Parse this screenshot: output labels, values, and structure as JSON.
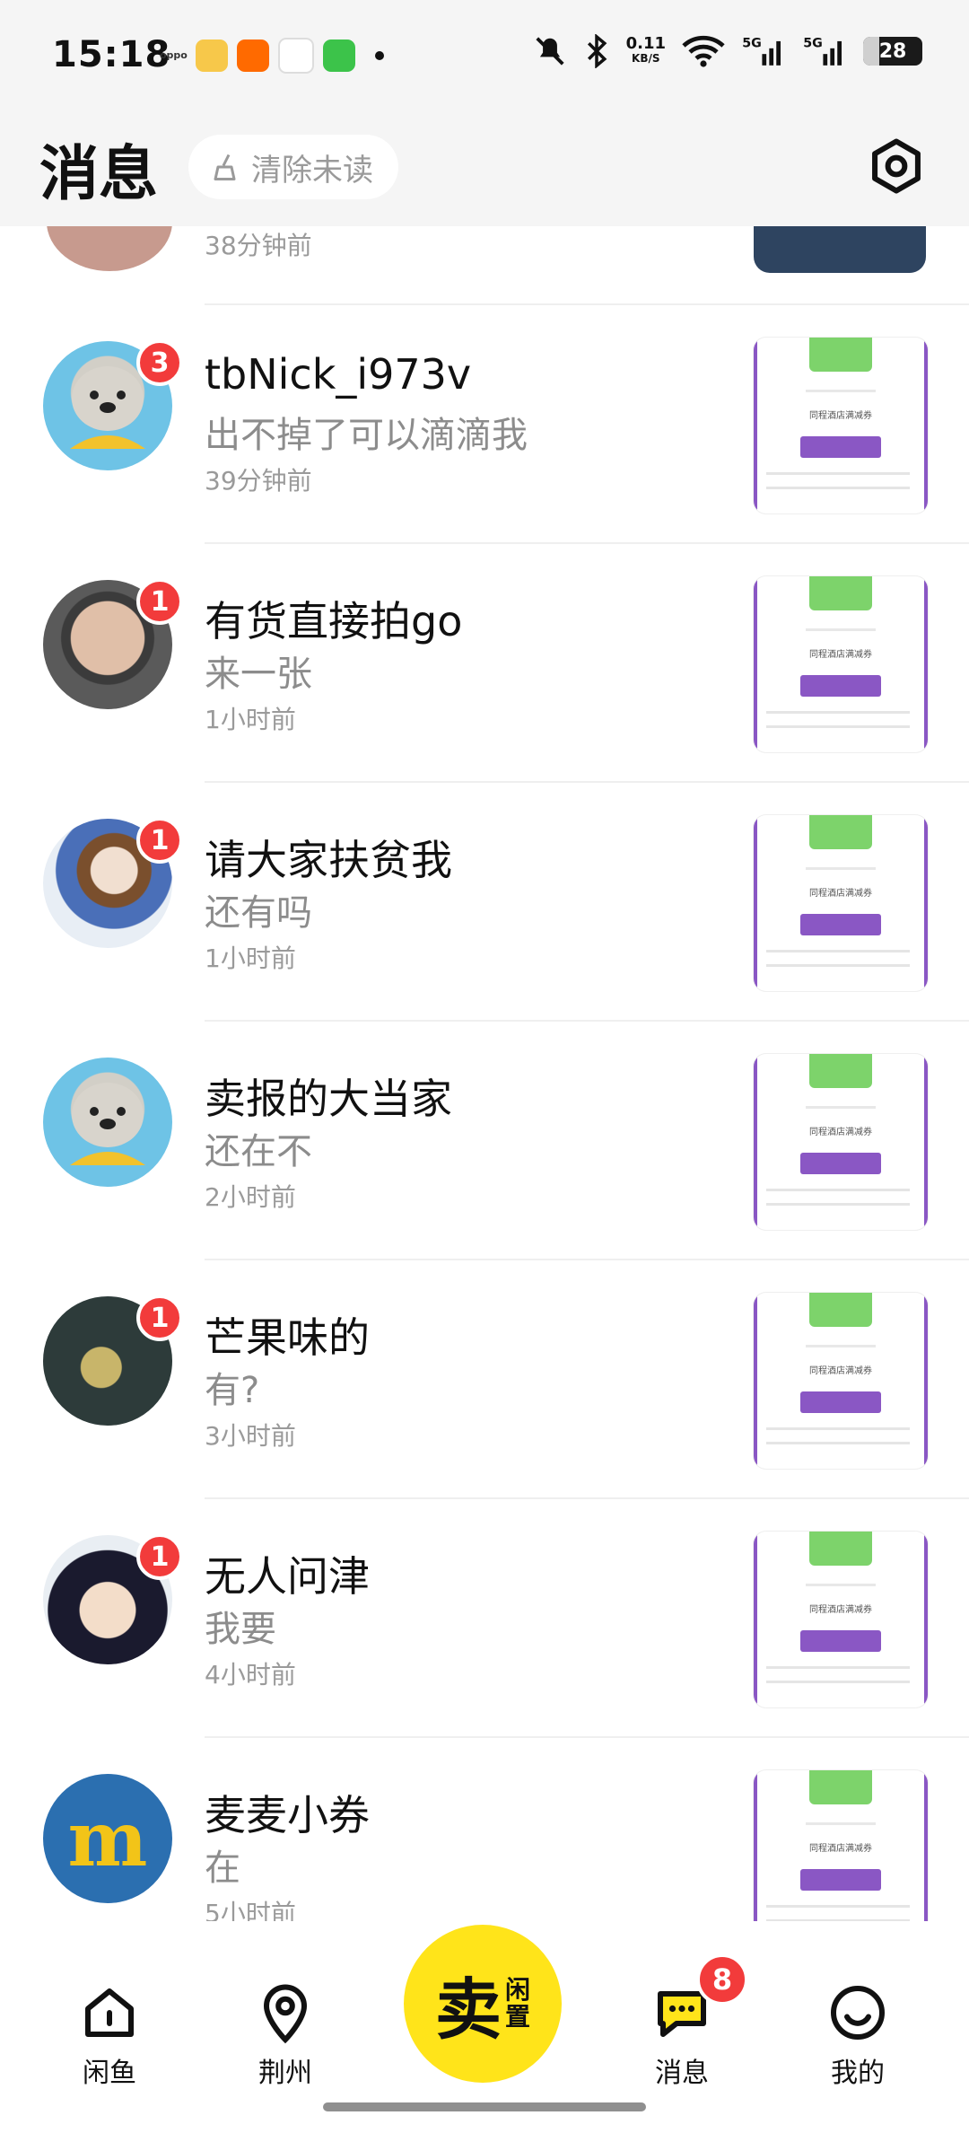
{
  "status_bar": {
    "time": "15:18",
    "oppo_label": "oppo",
    "net_speed_value": "0.11",
    "net_speed_unit": "KB/S",
    "battery": "28",
    "battery_level_percent": 28
  },
  "header": {
    "title": "消息",
    "clear_unread_label": "清除未读"
  },
  "partial_message": {
    "time": "38分钟前"
  },
  "messages": [
    {
      "name": "tbNick_i973v",
      "preview": "出不掉了可以滴滴我",
      "time": "39分钟前",
      "unread": "3",
      "avatar": "cat-avatar"
    },
    {
      "name": "有货直接拍go",
      "preview": "来一张",
      "time": "1小时前",
      "unread": "1",
      "avatar": "photo-avatar"
    },
    {
      "name": "请大家扶贫我",
      "preview": "还有吗",
      "time": "1小时前",
      "unread": "1",
      "avatar": "anime-avatar"
    },
    {
      "name": "卖报的大当家",
      "preview": "还在不",
      "time": "2小时前",
      "unread": "",
      "avatar": "cat-avatar"
    },
    {
      "name": "芒果味的",
      "preview": "有?",
      "time": "3小时前",
      "unread": "1",
      "avatar": "fish-avatar"
    },
    {
      "name": "无人问津",
      "preview": "我要",
      "time": "4小时前",
      "unread": "1",
      "avatar": "anime-avatar"
    },
    {
      "name": "麦麦小券",
      "preview": "在",
      "time": "5小时前",
      "unread": "",
      "avatar": "m-logo-avatar"
    }
  ],
  "thumbnail": {
    "title": "同程酒店满减券"
  },
  "bottom_nav": {
    "home": "闲鱼",
    "city": "荆州",
    "sell_main": "卖",
    "sell_sub_1": "闲",
    "sell_sub_2": "置",
    "messages": "消息",
    "messages_badge": "8",
    "profile": "我的"
  },
  "colors": {
    "accent_yellow": "#ffe41a",
    "badge_red": "#f23b3b",
    "coupon_purple": "#8a57c4",
    "coupon_green": "#7dd36b"
  }
}
